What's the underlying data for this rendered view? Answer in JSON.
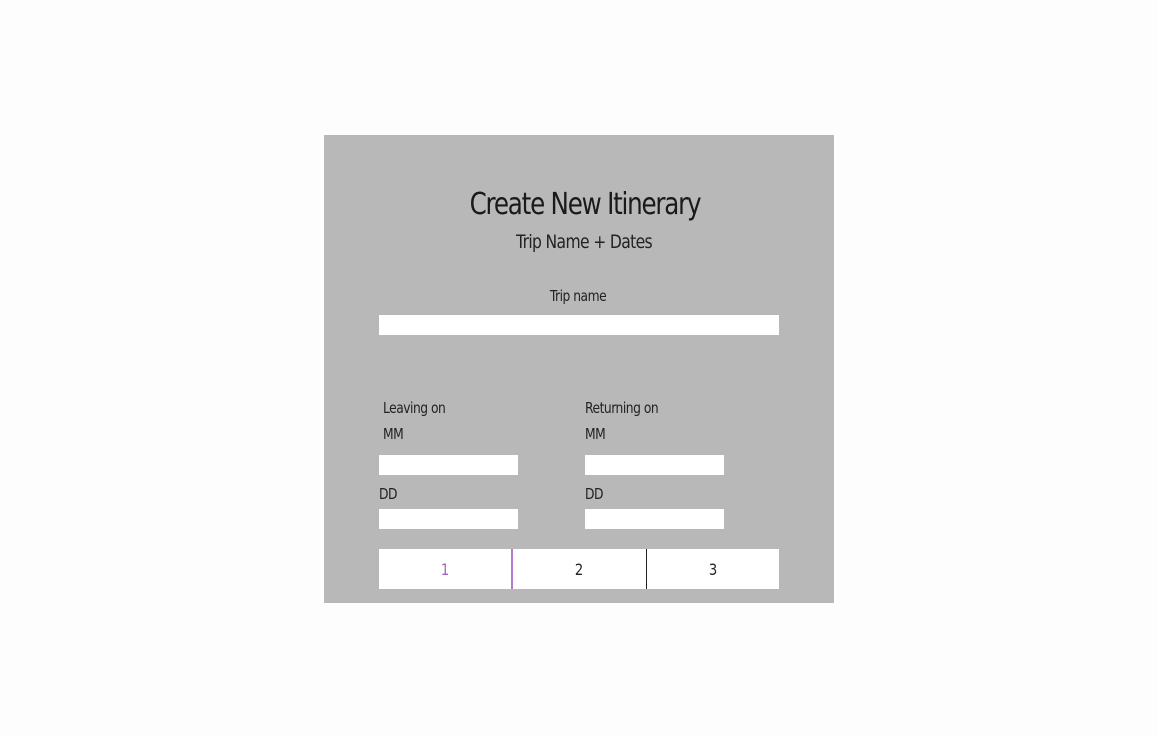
{
  "form": {
    "title": "Create New Itinerary",
    "subtitle": "Trip Name + Dates",
    "trip_name_label": "Trip name",
    "trip_name_value": "",
    "leaving": {
      "label": "Leaving on",
      "mm_label": "MM",
      "mm_value": "",
      "dd_label": "DD",
      "dd_value": ""
    },
    "returning": {
      "label": "Returning on",
      "mm_label": "MM",
      "mm_value": "",
      "dd_label": "DD",
      "dd_value": ""
    }
  },
  "stepper": {
    "steps": [
      "1",
      "2",
      "3"
    ],
    "active_step": "1",
    "active_color": "#a65fc4"
  },
  "colors": {
    "card_background": "#b8b8b8",
    "page_background": "#fdfdfd"
  }
}
